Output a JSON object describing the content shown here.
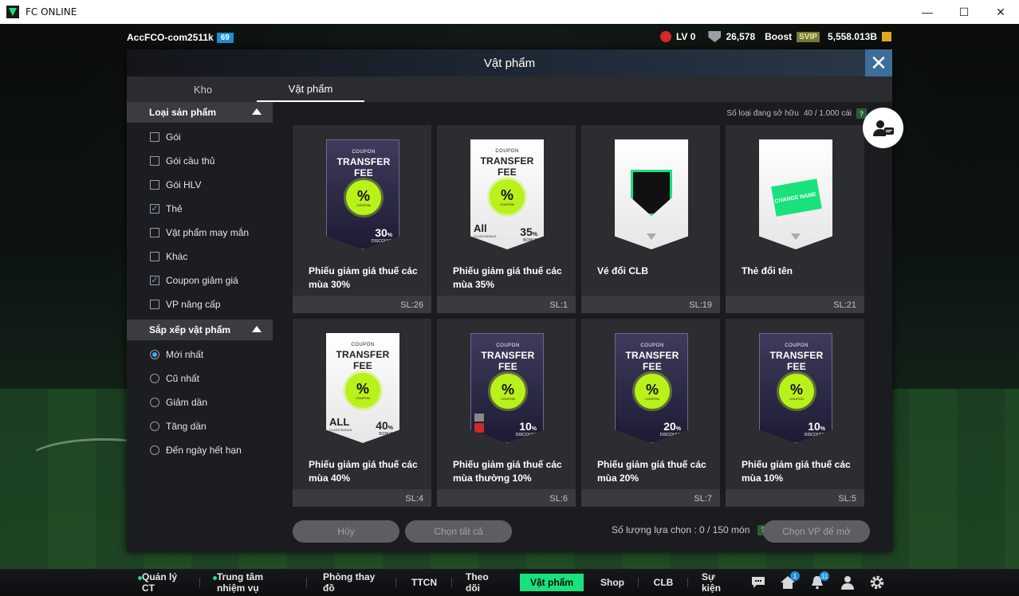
{
  "window": {
    "title": "FC ONLINE",
    "minimize": "—",
    "maximize": "☐",
    "close": "✕"
  },
  "topbar": {
    "account": "AccFCO-com2511k",
    "level": "69",
    "lv": "LV 0",
    "points": "26,578",
    "boost": "Boost",
    "svip": "SVIP",
    "bp": "5,558.013B"
  },
  "modal": {
    "title": "Vật phẩm",
    "close": "✕",
    "tabs": [
      {
        "label": "Kho",
        "active": false
      },
      {
        "label": "Vật phẩm",
        "active": true
      }
    ],
    "owned_label": "Số loại đang sở hữu",
    "owned_value": "40 / 1.000 cái",
    "help": "?"
  },
  "sidebar": {
    "product_type_title": "Loại sản phẩm",
    "product_types": [
      {
        "label": "Gói",
        "checked": false
      },
      {
        "label": "Gói cầu thủ",
        "checked": false
      },
      {
        "label": "Gói HLV",
        "checked": false
      },
      {
        "label": "Thẻ",
        "checked": true
      },
      {
        "label": "Vật phẩm may mắn",
        "checked": false
      },
      {
        "label": "Khác",
        "checked": false
      },
      {
        "label": "Coupon giảm giá",
        "checked": true
      },
      {
        "label": "VP nâng cấp",
        "checked": false
      }
    ],
    "sort_title": "Sắp xếp vật phẩm",
    "sort_options": [
      {
        "label": "Mới nhất",
        "selected": true
      },
      {
        "label": "Cũ nhất",
        "selected": false
      },
      {
        "label": "Giảm dần",
        "selected": false
      },
      {
        "label": "Tăng dần",
        "selected": false
      },
      {
        "label": "Đến ngày hết hạn",
        "selected": false
      }
    ]
  },
  "items": [
    {
      "name": "Phiếu giảm giá thuế các mùa 30%",
      "qty": "SL:26",
      "kind": "coupon",
      "style": "dark",
      "coupon": "COUPON",
      "title": "TRANSFER FEE",
      "pct": "%",
      "seal": "COUPON",
      "disc": "30",
      "disc_unit": "%",
      "disc_label": "DISCOUNT",
      "all": ""
    },
    {
      "name": "Phiếu giảm giá thuế các mùa 35%",
      "qty": "SL:1",
      "kind": "coupon",
      "style": "light",
      "coupon": "COUPON",
      "title": "TRANSFER FEE",
      "pct": "%",
      "seal": "COUPON",
      "disc": "35",
      "disc_unit": "%",
      "disc_label": "BONUS",
      "all": "All",
      "all_sub": "CLASS BONUS"
    },
    {
      "name": "Vé đổi CLB",
      "qty": "SL:19",
      "kind": "club"
    },
    {
      "name": "Thẻ đổi tên",
      "qty": "SL:21",
      "kind": "rename",
      "tag": "CHANGE NAME"
    },
    {
      "name": "Phiếu giảm giá thuế các mùa 40%",
      "qty": "SL:4",
      "kind": "coupon",
      "style": "light",
      "coupon": "COUPON",
      "title": "TRANSFER FEE",
      "pct": "%",
      "seal": "COUPON",
      "disc": "40",
      "disc_unit": "%",
      "disc_label": "BONUS",
      "all": "ALL",
      "all_sub": "CLASS BONUS"
    },
    {
      "name": "Phiếu giảm giá thuế các mùa thường 10%",
      "qty": "SL:6",
      "kind": "coupon",
      "style": "dark",
      "coupon": "COUPON",
      "title": "TRANSFER FEE",
      "pct": "%",
      "seal": "COUPON",
      "disc": "10",
      "disc_unit": "%",
      "disc_label": "DISCOUNT",
      "all": "",
      "marks": true
    },
    {
      "name": "Phiếu giảm giá thuế các mùa 20%",
      "qty": "SL:7",
      "kind": "coupon",
      "style": "dark",
      "coupon": "COUPON",
      "title": "TRANSFER FEE",
      "pct": "%",
      "seal": "COUPON",
      "disc": "20",
      "disc_unit": "%",
      "disc_label": "DISCOUNT",
      "all": ""
    },
    {
      "name": "Phiếu giảm giá thuế các mùa 10%",
      "qty": "SL:5",
      "kind": "coupon",
      "style": "dark",
      "coupon": "COUPON",
      "title": "TRANSFER FEE",
      "pct": "%",
      "seal": "COUPON",
      "disc": "10",
      "disc_unit": "%",
      "disc_label": "DISCOUNT",
      "all": ""
    }
  ],
  "footer": {
    "cancel": "Hủy",
    "select_all": "Chọn tất cả",
    "select_count_label": "Số lượng lựa chọn : 0 / 150 món",
    "help": "?",
    "select_vp": "Chọn VP để mở"
  },
  "nav": {
    "items": [
      {
        "label": "Quản lý CT",
        "dot": true,
        "active": false
      },
      {
        "label": "Trung tâm nhiệm vụ",
        "dot": true,
        "active": false
      },
      {
        "label": "Phòng thay đồ",
        "dot": false,
        "active": false
      },
      {
        "label": "TTCN",
        "dot": false,
        "active": false
      },
      {
        "label": "Theo dõi",
        "dot": false,
        "active": false
      },
      {
        "label": "Vật phẩm",
        "dot": false,
        "active": true
      },
      {
        "label": "Shop",
        "dot": false,
        "active": false
      },
      {
        "label": "CLB",
        "dot": false,
        "active": false
      },
      {
        "label": "Sự kiện",
        "dot": false,
        "active": false
      }
    ],
    "home_badge": "1",
    "bell_badge": "11"
  },
  "colors": {
    "accent": "#19e27d",
    "info": "#1e8fd6",
    "seal": "#b8f21a"
  }
}
